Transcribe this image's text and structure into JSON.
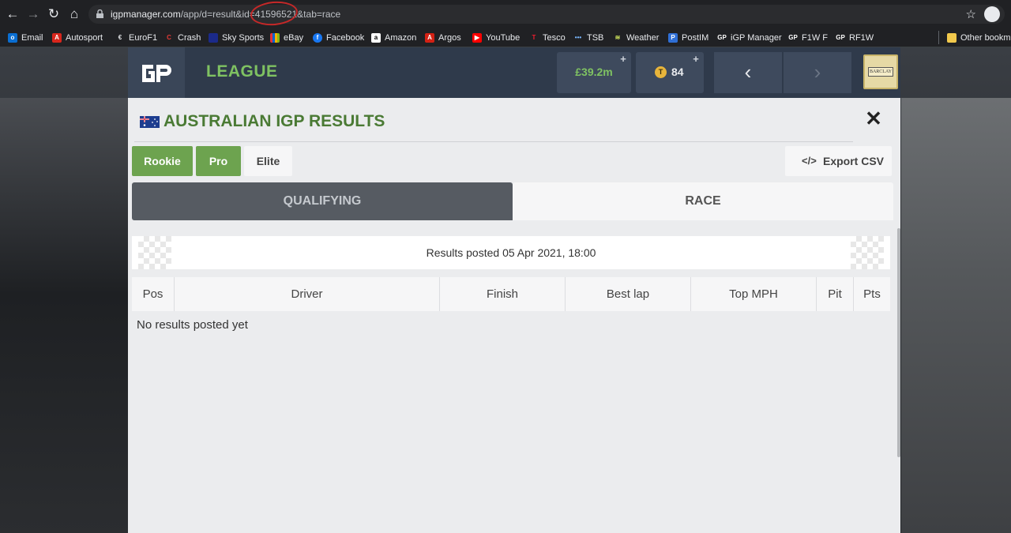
{
  "browser": {
    "url_host": "igpmanager.com",
    "url_path": "/app/d=result&id=41596521&tab=race",
    "bookmarks": [
      "Email",
      "Autosport",
      "EuroF1",
      "Crash",
      "Sky Sports",
      "eBay",
      "Facebook",
      "Amazon",
      "Argos",
      "YouTube",
      "Tesco",
      "TSB",
      "Weather",
      "PostIM",
      "iGP Manager",
      "F1W F",
      "RF1W",
      "Other bookma"
    ]
  },
  "header": {
    "section": "LEAGUE",
    "money": "£39.2m",
    "tokens": "84",
    "sponsor": "BARCLAY"
  },
  "modal": {
    "title": "AUSTRALIAN IGP RESULTS",
    "tiers": [
      "Rookie",
      "Pro",
      "Elite"
    ],
    "export_label": "Export CSV",
    "tabs": [
      "QUALIFYING",
      "RACE"
    ],
    "posted": "Results posted 05 Apr 2021, 18:00",
    "columns": [
      "Pos",
      "Driver",
      "Finish",
      "Best lap",
      "Top MPH",
      "Pit",
      "Pts"
    ],
    "empty_message": "No results posted yet"
  },
  "colors": {
    "accent_green": "#7fc262",
    "tier_active": "#6da34f",
    "title_green": "#4a7a34",
    "header_bg": "#2f3a4b"
  }
}
